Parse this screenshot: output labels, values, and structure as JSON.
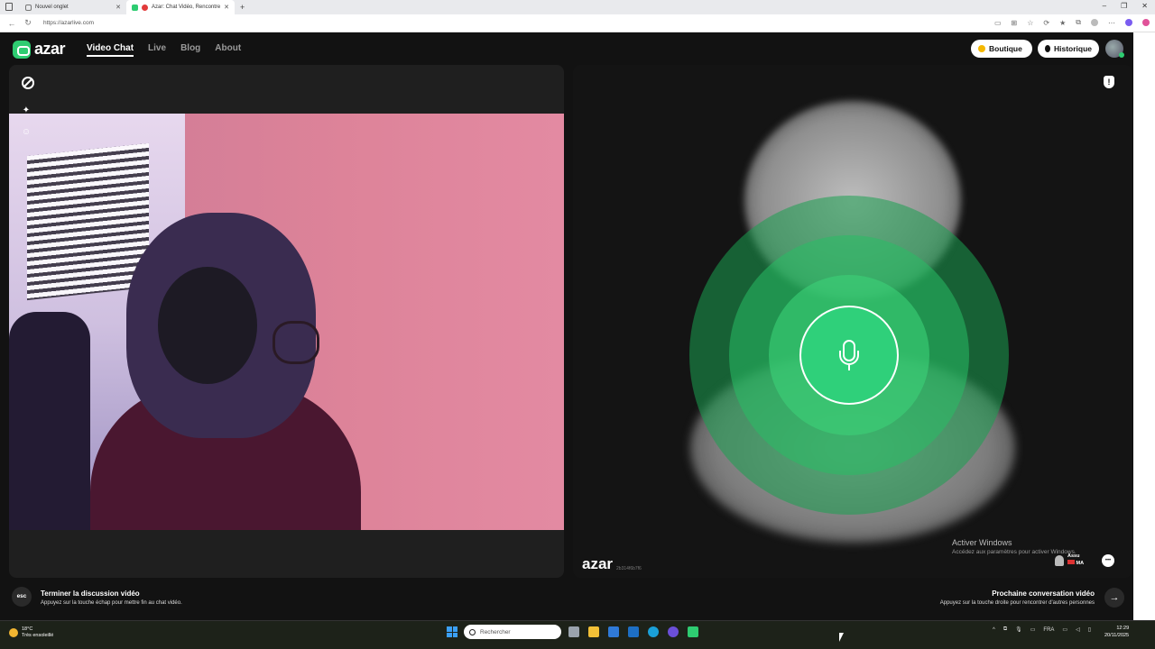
{
  "browser": {
    "tabs": [
      {
        "label": "Nouvel onglet"
      },
      {
        "label": "Azar: Chat Vidéo, Rencontre"
      }
    ],
    "url": "https://azarlive.com"
  },
  "header": {
    "logo": "azar",
    "nav": [
      {
        "label": "Video Chat",
        "active": true
      },
      {
        "label": "Live"
      },
      {
        "label": "Blog"
      },
      {
        "label": "About"
      }
    ],
    "boutique_label": "Boutique",
    "historique_label": "Historique"
  },
  "right_panel": {
    "watermark": "azar",
    "watermark_id": "2b314f6b7f6",
    "user_name": "Assu",
    "user_country": "MA"
  },
  "bottom": {
    "esc_label": "esc",
    "end_title": "Terminer la discussion vidéo",
    "end_sub": "Appuyez sur la touche échap pour mettre fin au chat vidéo.",
    "next_title": "Prochaine conversation vidéo",
    "next_sub": "Appuyez sur la touche droite pour rencontrer d'autres personnes",
    "next_arrow": "→"
  },
  "windows_activation": {
    "title": "Activer Windows",
    "sub": "Accédez aux paramètres pour activer Windows."
  },
  "taskbar": {
    "weather_temp": "18°C",
    "weather_desc": "Très ensoleillé",
    "search_placeholder": "Rechercher",
    "language": "FRA",
    "time": "12:29",
    "date": "20/11/2025"
  },
  "colors": {
    "accent": "#2ecc71",
    "ring_outer": "#19a050",
    "mic": "#2fd07a"
  }
}
